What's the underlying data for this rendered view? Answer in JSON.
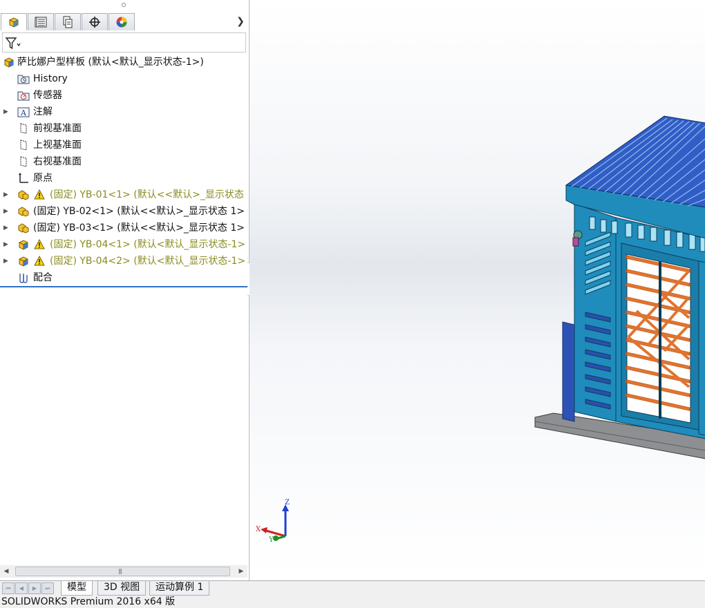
{
  "feature_tree": {
    "root": {
      "label": "萨比娜户型样板  (默认<默认_显示状态-1>)"
    },
    "items": [
      {
        "label": "History",
        "icon": "history-icon",
        "expandable": false
      },
      {
        "label": "传感器",
        "icon": "sensor-icon",
        "expandable": false
      },
      {
        "label": "注解",
        "icon": "annotation-icon",
        "expandable": true
      },
      {
        "label": "前视基准面",
        "icon": "plane-icon",
        "expandable": false
      },
      {
        "label": "上视基准面",
        "icon": "plane-icon",
        "expandable": false
      },
      {
        "label": "右视基准面",
        "icon": "plane-icon",
        "expandable": false
      },
      {
        "label": "原点",
        "icon": "origin-icon",
        "expandable": false
      },
      {
        "label": "(固定) YB-01<1> (默认<<默认>_显示状态",
        "icon": "subassembly-icon",
        "warning": true,
        "expandable": true
      },
      {
        "label": "(固定) YB-02<1> (默认<<默认>_显示状态 1>",
        "icon": "subassembly-icon",
        "warning": false,
        "expandable": true
      },
      {
        "label": "(固定) YB-03<1> (默认<<默认>_显示状态 1>",
        "icon": "subassembly-icon",
        "warning": false,
        "expandable": true
      },
      {
        "label": "(固定) YB-04<1> (默认<默认_显示状态-1>",
        "icon": "assembly-icon",
        "warning": true,
        "expandable": true
      },
      {
        "label": "(固定) YB-04<2> (默认<默认_显示状态-1>",
        "icon": "assembly-icon",
        "warning": true,
        "expandable": true
      },
      {
        "label": "配合",
        "icon": "mates-icon",
        "expandable": false
      }
    ]
  },
  "bottom_tabs": [
    "模型",
    "3D 视图",
    "运动算例 1"
  ],
  "status": {
    "text": "SOLIDWORKS Premium 2016 x64 版"
  },
  "triad": {
    "z": "Z",
    "x": "X",
    "y": "Y"
  },
  "colors": {
    "warning_text": "#8b8b1f",
    "roof": "#2f5fc6",
    "walls": "#1f8fc0",
    "lattice": "#e0742f"
  }
}
